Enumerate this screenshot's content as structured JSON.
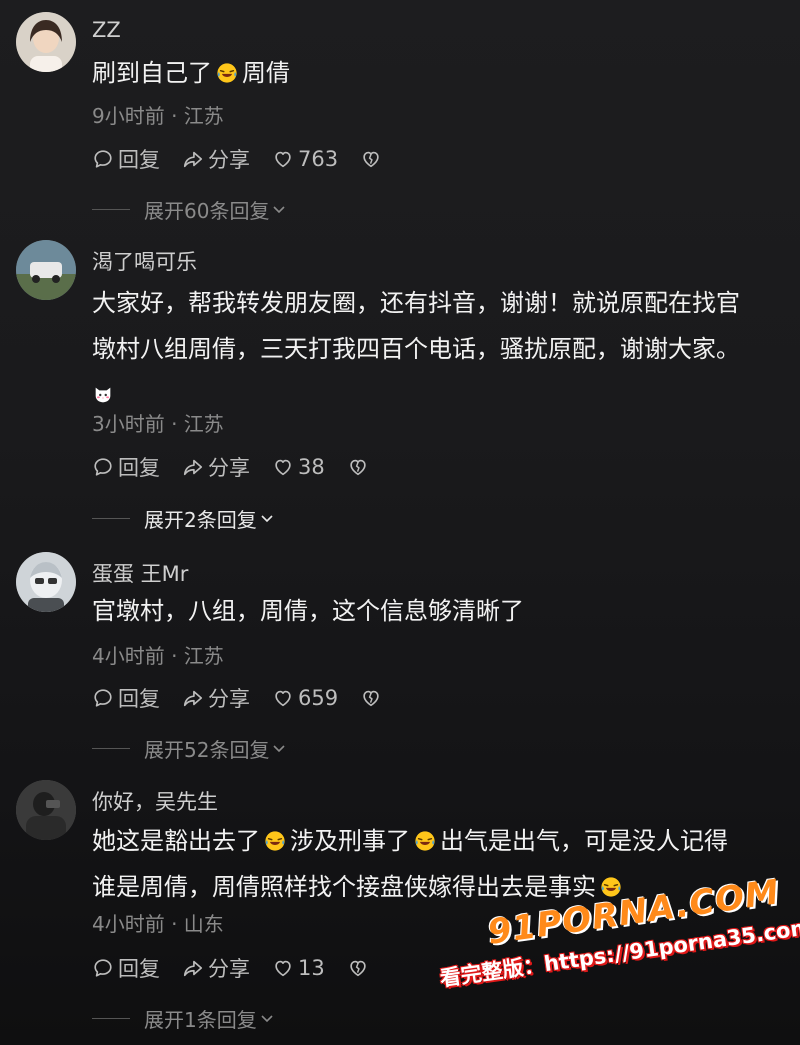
{
  "comments": [
    {
      "name": "ZZ",
      "text_parts": [
        "刷到自己了",
        "周倩"
      ],
      "meta": "9小时前 · 江苏",
      "reply": "回复",
      "share": "分享",
      "likes": "763",
      "expand": "展开60条回复"
    },
    {
      "name": "渴了喝可乐",
      "lines": [
        "大家好，帮我转发朋友圈，还有抖音，谢谢！就说原配在找官",
        "墩村八组周倩，三天打我四百个电话，骚扰原配，谢谢大家。"
      ],
      "meta": "3小时前 · 江苏",
      "reply": "回复",
      "share": "分享",
      "likes": "38",
      "expand": "展开2条回复"
    },
    {
      "name": "蛋蛋 王Mr",
      "text": "官墩村，八组，周倩，这个信息够清晰了",
      "meta": "4小时前 · 江苏",
      "reply": "回复",
      "share": "分享",
      "likes": "659",
      "expand": "展开52条回复"
    },
    {
      "name": "你好，吴先生",
      "line1_parts": [
        "她这是豁出去了",
        "涉及刑事了",
        "出气是出气，可是没人记得"
      ],
      "line2": "谁是周倩，周倩照样找个接盘侠嫁得出去是事实",
      "meta": "4小时前 · 山东",
      "reply": "回复",
      "share": "分享",
      "likes": "13",
      "expand": "展开1条回复"
    }
  ],
  "watermark": {
    "logo": "91PORNA.COM",
    "url": "看完整版：https://91porna35.com"
  },
  "colors": {
    "background": "#1a1a1c",
    "text": "#f2f2f2",
    "meta": "#8a8a8a",
    "watermark_orange": "#ff8a1a",
    "watermark_red": "#e01818"
  },
  "icons": [
    "laugh-cry-emoji",
    "cat-emoji",
    "comment-bubble-icon",
    "share-arrow-icon",
    "heart-icon",
    "broken-heart-icon",
    "chevron-down-icon"
  ]
}
